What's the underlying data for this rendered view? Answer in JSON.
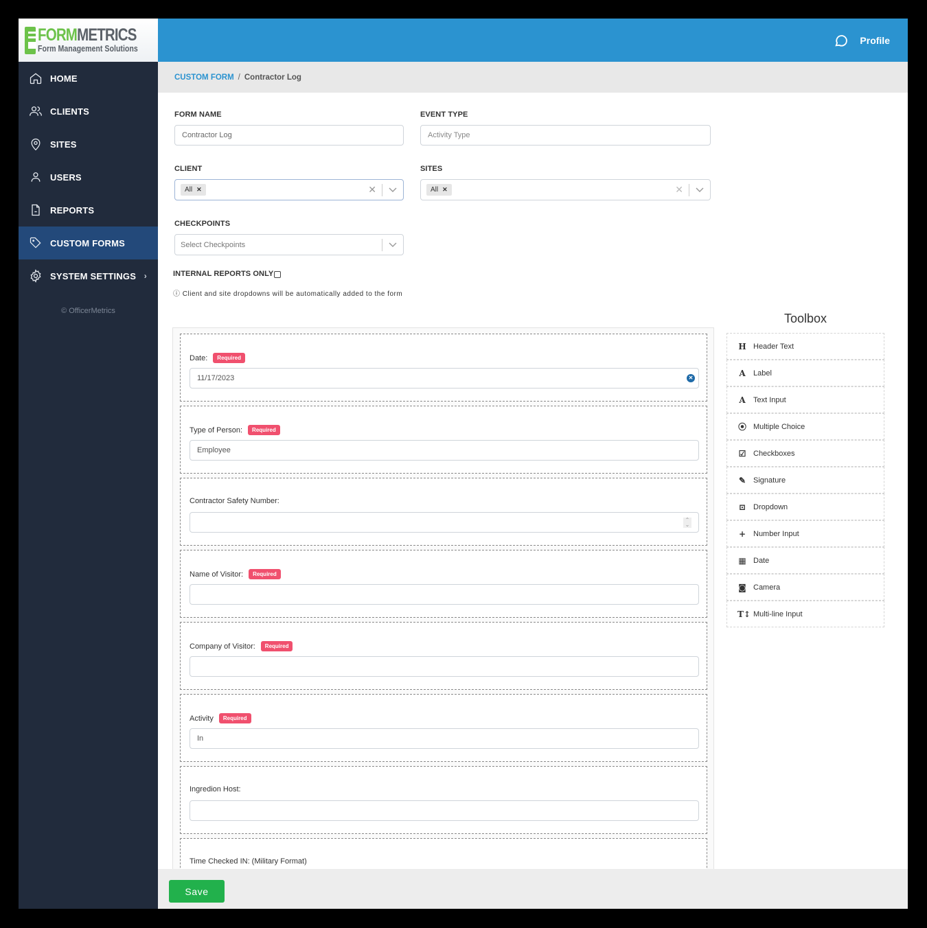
{
  "brand": {
    "title_green": "FORM",
    "title_dark": "METRICS",
    "subtitle": "Form Management Solutions"
  },
  "sidebar": {
    "items": [
      {
        "label": "HOME",
        "icon": "home-icon"
      },
      {
        "label": "CLIENTS",
        "icon": "users-icon"
      },
      {
        "label": "SITES",
        "icon": "map-pin-icon"
      },
      {
        "label": "USERS",
        "icon": "user-icon"
      },
      {
        "label": "REPORTS",
        "icon": "file-icon"
      },
      {
        "label": "CUSTOM FORMS",
        "icon": "tag-icon",
        "active": true
      },
      {
        "label": "SYSTEM SETTINGS",
        "icon": "gear-icon",
        "chevron": "›"
      }
    ],
    "copyright": "© OfficerMetrics"
  },
  "header": {
    "profile_label": "Profile"
  },
  "breadcrumb": {
    "parent": "CUSTOM FORM",
    "separator": "/",
    "current": "Contractor Log"
  },
  "form": {
    "form_name_label": "FORM NAME",
    "form_name_value": "Contractor Log",
    "event_type_label": "EVENT TYPE",
    "event_type_placeholder": "Activity Type",
    "client_label": "CLIENT",
    "client_chip": "All",
    "sites_label": "SITES",
    "sites_chip": "All",
    "checkpoints_label": "CHECKPOINTS",
    "checkpoints_placeholder": "Select Checkpoints",
    "internal_label": "INTERNAL REPORTS ONLY",
    "internal_checked": false,
    "note": "ⓘ Client and site dropdowns will be automatically added to the form"
  },
  "canvas": {
    "required_badge": "Required",
    "fields": [
      {
        "label": "Date:",
        "required": true,
        "value": "11/17/2023",
        "type": "date"
      },
      {
        "label": "Type of Person:",
        "required": true,
        "value": "Employee",
        "type": "dropdown"
      },
      {
        "label": "Contractor Safety Number:",
        "required": false,
        "value": "",
        "type": "number"
      },
      {
        "label": "Name of Visitor:",
        "required": true,
        "value": "",
        "type": "text"
      },
      {
        "label": "Company of Visitor:",
        "required": true,
        "value": "",
        "type": "text"
      },
      {
        "label": "Activity",
        "required": true,
        "value": "In",
        "type": "dropdown"
      },
      {
        "label": "Ingredion Host:",
        "required": false,
        "value": "",
        "type": "text"
      },
      {
        "label": "Time Checked IN: (Military Format)",
        "required": false,
        "value": "",
        "type": "number"
      }
    ]
  },
  "toolbox": {
    "title": "Toolbox",
    "items": [
      {
        "label": "Header Text",
        "glyph": "H",
        "icon": "header-icon"
      },
      {
        "label": "Label",
        "glyph": "A",
        "icon": "font-icon"
      },
      {
        "label": "Text Input",
        "glyph": "A",
        "icon": "font-icon"
      },
      {
        "label": "Multiple Choice",
        "glyph": "⦿",
        "icon": "radio-icon"
      },
      {
        "label": "Checkboxes",
        "glyph": "☑",
        "icon": "checkbox-icon"
      },
      {
        "label": "Signature",
        "glyph": "✎",
        "icon": "signature-icon"
      },
      {
        "label": "Dropdown",
        "glyph": "⊡",
        "icon": "dropdown-icon"
      },
      {
        "label": "Number Input",
        "glyph": "+",
        "icon": "plus-icon"
      },
      {
        "label": "Date",
        "glyph": "▦",
        "icon": "calendar-icon"
      },
      {
        "label": "Camera",
        "glyph": "◙",
        "icon": "camera-icon"
      },
      {
        "label": "Multi-line Input",
        "glyph": "T↕",
        "icon": "text-height-icon"
      }
    ]
  },
  "footer": {
    "save_label": "Save"
  },
  "colors": {
    "header": "#2b93d0",
    "sidebar": "#212b3c",
    "sidebar_active": "#23497a",
    "required_badge": "#f0506e",
    "save_button": "#22b14c",
    "brand_green": "#6cc24a"
  }
}
